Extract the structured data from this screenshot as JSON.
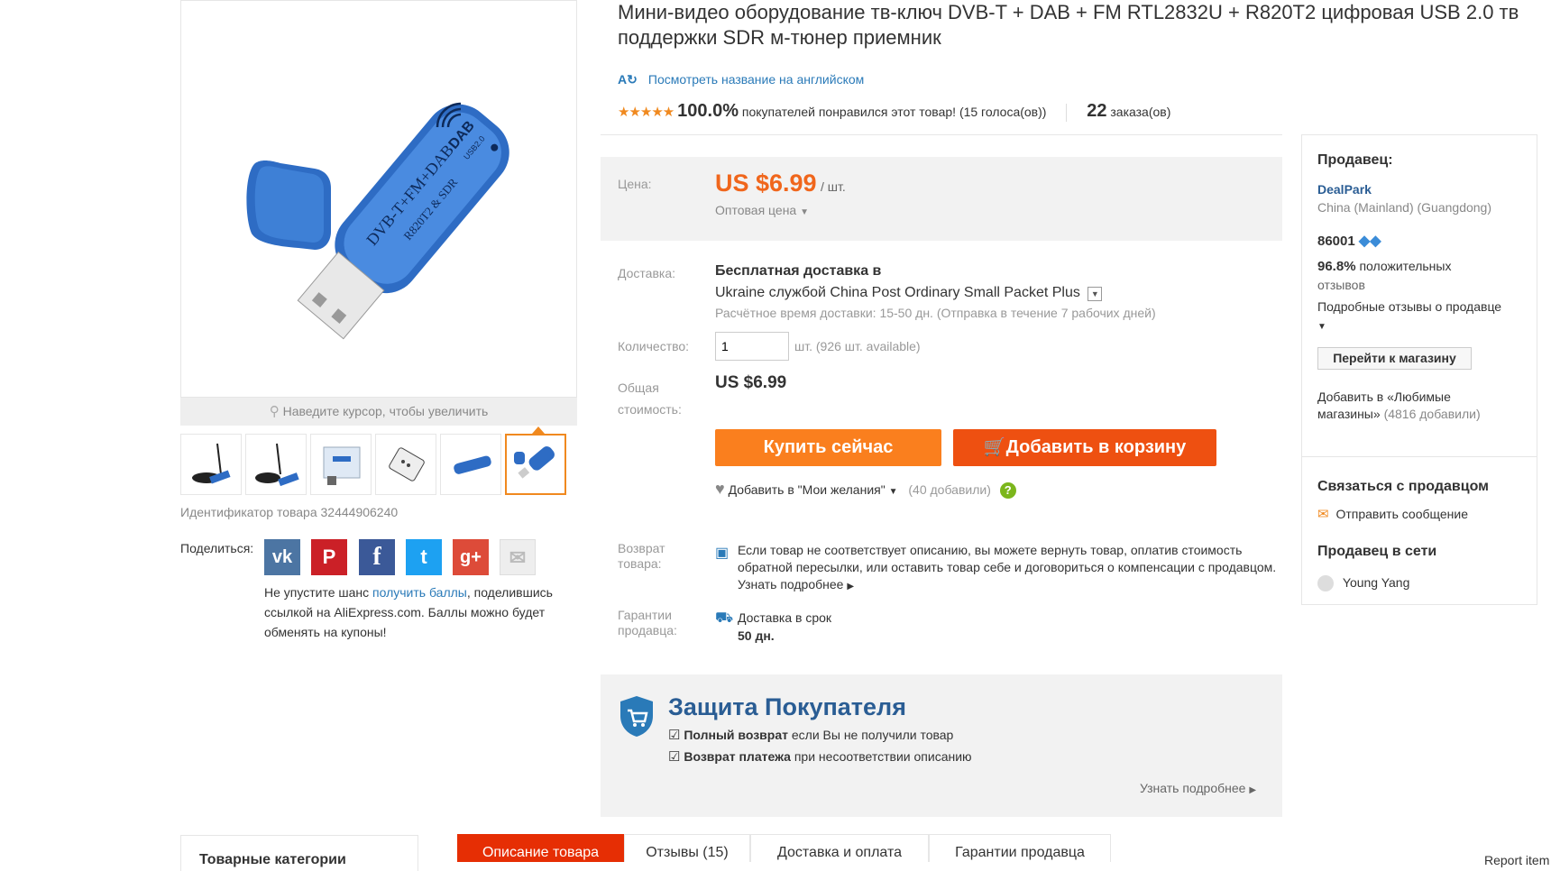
{
  "product": {
    "title": "Мини-видео оборудование тв-ключ DVB-T + DAB + FM RTL2832U + R820T2 цифровая USB 2.0 тв поддержки SDR м-тюнер приемник",
    "translate_link": "Посмотреть название на английском",
    "rating_percent": "100.0%",
    "rating_text": "покупателей понравился этот товар! (15 голоса(ов))",
    "orders_count": "22",
    "orders_label": "заказа(ов)",
    "id_text": "Идентификатор товара 32444906240",
    "zoom_hint": "Наведите курсор, чтобы увеличить",
    "device_labels": {
      "main": "DVB-T+FM+DAB",
      "sub": "R820T2 & SDR",
      "brand": "DAB",
      "usb": "USB2.0"
    }
  },
  "share": {
    "label": "Поделиться:",
    "text_before": "Не упустите шанс ",
    "link": "получить баллы",
    "text_after": ", поделившись ссылкой на AliExpress.com. Баллы можно будет обменять на купоны!",
    "networks": [
      {
        "name": "vk",
        "glyph": "vk",
        "color": "#4c75a3"
      },
      {
        "name": "pinterest",
        "glyph": "P",
        "color": "#cb2027"
      },
      {
        "name": "facebook",
        "glyph": "f",
        "color": "#3b5998"
      },
      {
        "name": "twitter",
        "glyph": "t",
        "color": "#1da1f2"
      },
      {
        "name": "google-plus",
        "glyph": "g+",
        "color": "#dd4b39"
      },
      {
        "name": "email",
        "glyph": "✉",
        "color": "#eeeeee"
      }
    ]
  },
  "price": {
    "label": "Цена:",
    "value": "US $6.99",
    "unit": "/ шт.",
    "wholesale": "Оптовая цена"
  },
  "delivery": {
    "label": "Доставка:",
    "free": "Бесплатная доставка",
    "in": "в",
    "route": "Ukraine службой China Post Ordinary Small Packet Plus",
    "estimate": "Расчётное время доставки: 15-50 дн. (Отправка в течение 7 рабочих дней)"
  },
  "quantity": {
    "label": "Количество:",
    "value": "1",
    "unit": "шт. (926 шт. available)"
  },
  "total": {
    "label_line1": "Общая",
    "label_line2": "стоимость:",
    "value": "US $6.99"
  },
  "actions": {
    "buy": "Купить сейчас",
    "cart": "Добавить в корзину",
    "wishlist": "Добавить в \"Мои желания\"",
    "wishlist_count": "(40 добавили)"
  },
  "returns": {
    "label_line1": "Возврат",
    "label_line2": "товара:",
    "text": "Если товар не соответствует описанию, вы можете вернуть товар, оплатив стоимость обратной пересылки, или оставить товар себе и договориться о компенсации с продавцом.",
    "more": "Узнать подробнее"
  },
  "guarantee": {
    "label_line1": "Гарантии",
    "label_line2": "продавца:",
    "line1": "Доставка в срок",
    "line2": "50 дн."
  },
  "protection": {
    "title": "Защита Покупателя",
    "item1_bold": "Полный возврат",
    "item1_rest": "если Вы не получили товар",
    "item2_bold": "Возврат платежа",
    "item2_rest": "при несоответствии описанию",
    "more": "Узнать подробнее"
  },
  "seller": {
    "heading": "Продавец:",
    "name": "DealPark",
    "location": "China (Mainland) (Guangdong)",
    "score": "86001",
    "positive_pct": "96.8%",
    "positive_line1": "положительных",
    "positive_line2": "отзывов",
    "details_link": "Подробные отзывы о продавце",
    "store_button": "Перейти к магазину",
    "favorite_line1": "Добавить в «Любимые",
    "favorite_line2": "магазины»",
    "favorite_count": "(4816 добавили)",
    "contact_heading": "Связаться с продавцом",
    "message_link": "Отправить сообщение",
    "online_heading": "Продавец в сети",
    "online_name": "Young Yang"
  },
  "bottom": {
    "categories": "Товарные категории",
    "tabs": [
      "Описание товара",
      "Отзывы (15)",
      "Доставка и оплата",
      "Гарантии продавца"
    ],
    "report": "Report item"
  },
  "colors": {
    "accent_orange": "#fa7f1e",
    "accent_red": "#ee5011",
    "price_orange": "#f0661c",
    "link_blue": "#2a7ab8",
    "tab_active": "#e62e04"
  }
}
